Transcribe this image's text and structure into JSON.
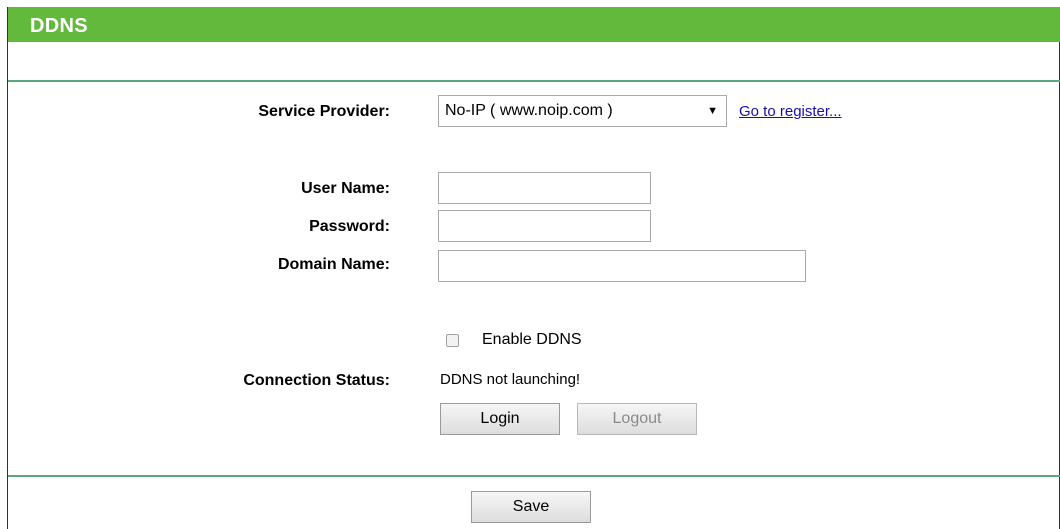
{
  "header": {
    "title": "DDNS"
  },
  "form": {
    "service_provider_label": "Service Provider:",
    "service_provider_value": "No-IP ( www.noip.com )",
    "register_link": "Go to register...",
    "username_label": "User Name:",
    "username_value": "",
    "password_label": "Password:",
    "password_value": "",
    "domain_label": "Domain Name:",
    "domain_value": "",
    "enable_label": "Enable DDNS",
    "enable_checked": false,
    "status_label": "Connection Status:",
    "status_value": "DDNS not launching!",
    "login_label": "Login",
    "logout_label": "Logout"
  },
  "footer": {
    "save_label": "Save"
  },
  "colors": {
    "header_green": "#63b93b",
    "divider": "#5aa77e",
    "link": "#1a0dab"
  },
  "icons": {
    "dropdown": "chevron-down-icon"
  }
}
